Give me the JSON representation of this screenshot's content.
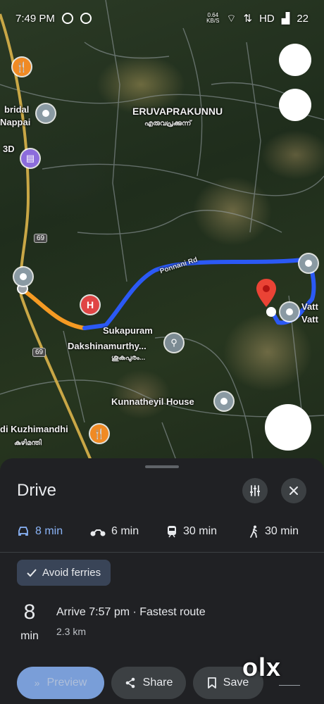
{
  "status_bar": {
    "time": "7:49 PM",
    "net_speed_value": "0.64",
    "net_speed_unit": "KB/S",
    "network_label": "HD",
    "battery": "22"
  },
  "map": {
    "labels": {
      "eruvaprakunnu": "ERUVAPRAKUNNU",
      "eruvaprakunnu_local": "എരുവപ്രക്കുന്ന്",
      "bridal_1": "bridal",
      "bridal_2": "Nappai",
      "three_d": "3D",
      "ponnani_rd": "Ponnani Rd",
      "sukapuram_1": "Sukapuram",
      "sukapuram_2": "Dakshinamurthy...",
      "sukapuram_local": "ശുകപുരം...",
      "kunnatheyil": "Kunnatheyil House",
      "kuzhimandhi": "di Kuzhimandhi",
      "kuzhimandhi_local": "കുഴിമന്തി",
      "vatta_1": "Vatt",
      "vatta_2": "Vatt",
      "road_69_a": "69",
      "road_69_b": "69"
    },
    "icons": [
      "restaurant-icon",
      "hospital-icon",
      "shopping-icon",
      "bicycle-icon",
      "place-pin-icon",
      "destination-marker-icon"
    ]
  },
  "sheet": {
    "title": "Drive",
    "options_icon": "tune-icon",
    "close_icon": "close-icon",
    "modes": [
      {
        "icon": "car-icon",
        "label": "8 min",
        "active": true
      },
      {
        "icon": "motorbike-icon",
        "label": "6 min",
        "active": false
      },
      {
        "icon": "train-icon",
        "label": "30 min",
        "active": false
      },
      {
        "icon": "walk-icon",
        "label": "30 min",
        "active": false
      }
    ],
    "chip_label": "Avoid ferries",
    "duration_number": "8",
    "duration_unit": "min",
    "arrive_text": "Arrive 7:57 pm · Fastest route",
    "distance": "2.3 km",
    "actions": {
      "preview": "Preview",
      "share": "Share",
      "save": "Save"
    },
    "watermark": "olx"
  },
  "colors": {
    "route_blue": "#2b59f5",
    "route_orange": "#f59a23",
    "accent": "#8ab4f8",
    "sheet_bg": "#202124"
  }
}
